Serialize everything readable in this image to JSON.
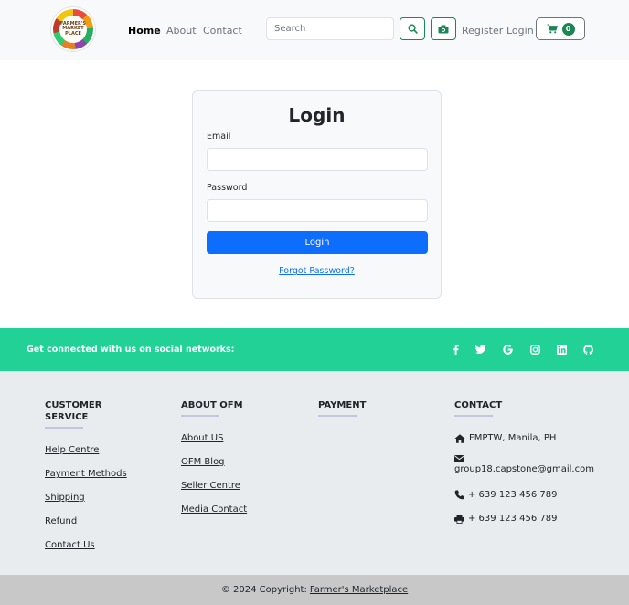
{
  "nav": {
    "logo_text": "FARMER'S MARKET PLACE",
    "links": [
      "Home",
      "About",
      "Contact"
    ],
    "search_placeholder": "Search",
    "register": "Register",
    "login": "Login",
    "cart_count": "0"
  },
  "login": {
    "title": "Login",
    "email_label": "Email",
    "password_label": "Password",
    "button": "Login",
    "forgot": "Forgot Password?"
  },
  "social": {
    "text": "Get connected with us on social networks:",
    "icons": [
      "facebook-icon",
      "twitter-icon",
      "google-icon",
      "instagram-icon",
      "linkedin-icon",
      "github-icon"
    ]
  },
  "footer": {
    "customer_service": {
      "title": "CUSTOMER SERVICE",
      "links": [
        "Help Centre",
        "Payment Methods",
        "Shipping",
        "Refund",
        "Contact Us"
      ]
    },
    "about": {
      "title": "ABOUT OFM",
      "links": [
        "About US",
        "OFM Blog",
        "Seller Centre",
        "Media Contact"
      ]
    },
    "payment": {
      "title": "PAYMENT"
    },
    "contact": {
      "title": "CONTACT",
      "address": "FMPTW, Manila, PH",
      "email": "group18.capstone@gmail.com",
      "phone": "+ 639 123 456 789",
      "fax": "+ 639 123 456 789"
    }
  },
  "copyright": {
    "text": "© 2024 Copyright:",
    "link": "Farmer's Marketplace"
  },
  "colors": {
    "primary": "#0d6efd",
    "success": "#198754",
    "social_bar": "#22d195",
    "footer_bg": "#e9ecef",
    "copyright_bg": "#c8c8c8"
  }
}
